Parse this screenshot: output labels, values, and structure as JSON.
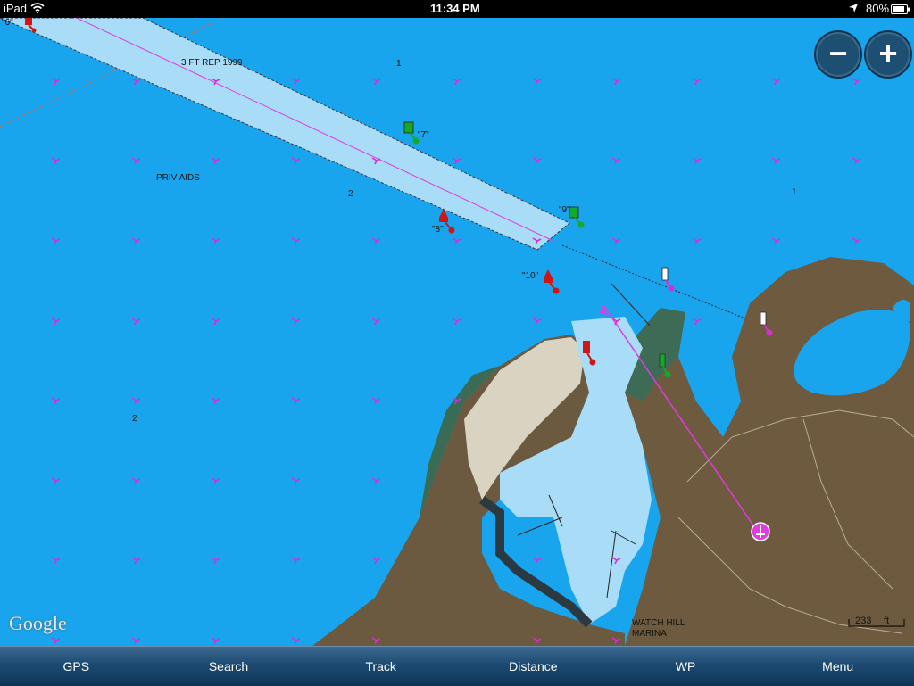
{
  "status_bar": {
    "device": "iPad",
    "time": "11:34 PM",
    "battery": "80%",
    "icons": [
      "wifi-icon",
      "location-arrow-icon",
      "battery-icon"
    ]
  },
  "map": {
    "labels": {
      "marker_6": "\"6\"",
      "marker_7": "\"7\"",
      "marker_8": "\"8\"",
      "marker_9": "\"9\"",
      "marker_10": "\"10\"",
      "depth_1a": "1",
      "depth_1b": "1",
      "depth_2a": "2",
      "depth_2b": "2",
      "channel_note": "3 FT REP 1999",
      "priv_aids": "PRIV AIDS",
      "marina_line1": "WATCH HILL",
      "marina_line2": "MARINA"
    },
    "attribution": "Google",
    "scale": {
      "value": "233",
      "unit": "ft"
    },
    "colors": {
      "water": "#19a5ee",
      "channel": "#a9dcf7",
      "route": "#e03ce0",
      "land": "#6e5a3f",
      "port_buoy": "#d01515",
      "starboard_buoy": "#16a82a"
    }
  },
  "zoom": {
    "minus": "−",
    "plus": "+"
  },
  "toolbar": {
    "gps": "GPS",
    "search": "Search",
    "track": "Track",
    "distance": "Distance",
    "wp": "WP",
    "menu": "Menu"
  }
}
